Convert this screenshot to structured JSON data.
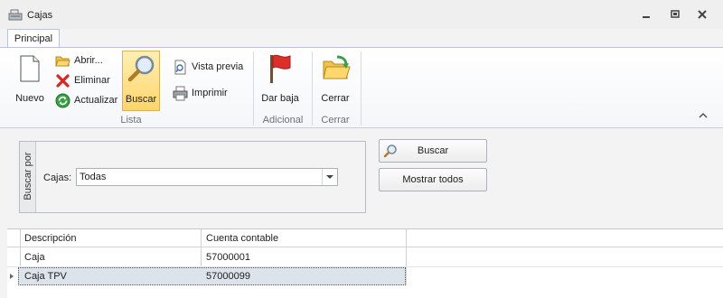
{
  "window": {
    "title": "Cajas",
    "icons": [
      "cash-register-icon",
      "minimize-icon",
      "restore-icon",
      "close-icon"
    ]
  },
  "ribbon": {
    "tab": "Principal",
    "groups": {
      "lista": "Lista",
      "adicional": "Adicional",
      "cerrar": "Cerrar"
    },
    "buttons": {
      "nuevo": "Nuevo",
      "abrir": "Abrir...",
      "eliminar": "Eliminar",
      "actualizar": "Actualizar",
      "buscar": "Buscar",
      "vista_previa": "Vista previa",
      "imprimir": "Imprimir",
      "dar_baja": "Dar baja",
      "cerrar": "Cerrar"
    }
  },
  "filter": {
    "side_label": "Buscar por",
    "field_label": "Cajas:",
    "selected": "Todas"
  },
  "actions": {
    "buscar": "Buscar",
    "mostrar_todos": "Mostrar todos"
  },
  "grid": {
    "columns": [
      "Descripción",
      "Cuenta contable"
    ],
    "rows": [
      {
        "descripcion": "Caja",
        "cuenta": "57000001",
        "selected": false
      },
      {
        "descripcion": "Caja TPV",
        "cuenta": "57000099",
        "selected": true
      }
    ]
  },
  "colors": {
    "accent": "#ffd56b",
    "ribbon_border": "#b9c5d6",
    "selection": "#dde3ea"
  }
}
